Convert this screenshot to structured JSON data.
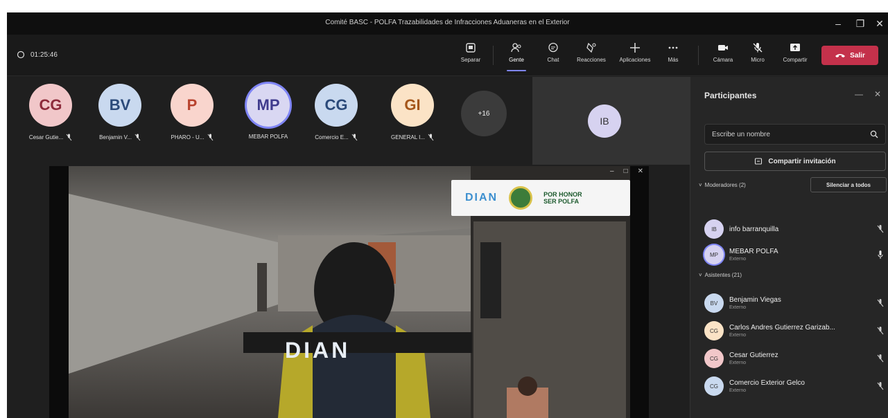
{
  "window": {
    "title": "Comité BASC - POLFA Trazabilidades de Infracciones Aduaneras en el Exterior"
  },
  "toolbar": {
    "timer": "01:25:46",
    "buttons": [
      {
        "name": "separate",
        "label": "Separar",
        "icon": "popout-icon"
      },
      {
        "name": "people",
        "label": "Gente",
        "icon": "people-icon",
        "active": true
      },
      {
        "name": "chat",
        "label": "Chat",
        "icon": "chat-icon"
      },
      {
        "name": "reactions",
        "label": "Reacciones",
        "icon": "reaction-icon"
      },
      {
        "name": "apps",
        "label": "Aplicaciones",
        "icon": "plus-icon"
      },
      {
        "name": "more",
        "label": "Más",
        "icon": "ellipsis-icon"
      },
      {
        "name": "camera",
        "label": "Cámara",
        "icon": "camera-icon"
      },
      {
        "name": "mic",
        "label": "Micro",
        "icon": "mic-off-icon"
      },
      {
        "name": "share",
        "label": "Compartir",
        "icon": "share-icon"
      }
    ],
    "leave_label": "Salir"
  },
  "strip": {
    "participants": [
      {
        "initials": "CG",
        "name": "Cesar Gutie...",
        "bg": "#f1c7c9",
        "fg": "#8d2b3b"
      },
      {
        "initials": "BV",
        "name": "Benjamin V...",
        "bg": "#c9d9ef",
        "fg": "#2b4a7a"
      },
      {
        "initials": "P",
        "name": "PHARO - U...",
        "bg": "#f9d5cd",
        "fg": "#b8432e"
      },
      {
        "initials": "MP",
        "name": "MEBAR POLFA",
        "bg": "#d9d7f2",
        "fg": "#3f3b8d",
        "speaking": true
      },
      {
        "initials": "CG",
        "name": "Comercio E...",
        "bg": "#c9d9ef",
        "fg": "#2b4a7a"
      },
      {
        "initials": "GI",
        "name": "GENERAL I...",
        "bg": "#fbe3c6",
        "fg": "#a5561a"
      }
    ],
    "more_count": "+16",
    "featured_initials": "IB"
  },
  "video": {
    "banner_brand": "DIAN",
    "banner_motto": "POR HONOR",
    "banner_unit": "SER POLFA",
    "vest_text": "DIAN"
  },
  "panel": {
    "title": "Participantes",
    "search_placeholder": "Escribe un nombre",
    "share_invite_label": "Compartir invitación",
    "moderators_label": "Moderadores (2)",
    "mute_all_label": "Silenciar a todos",
    "attendees_label": "Asistentes (21)",
    "moderators": [
      {
        "initials": "IB",
        "name": "info barranquilla",
        "subtitle": "",
        "bg": "#d6d2f0"
      },
      {
        "initials": "MP",
        "name": "MEBAR POLFA",
        "subtitle": "Externo",
        "bg": "#d6d2f0",
        "ring": true,
        "mic_on": true
      }
    ],
    "attendees": [
      {
        "initials": "BV",
        "name": "Benjamin Viegas",
        "subtitle": "Externo",
        "bg": "#c9d9ef"
      },
      {
        "initials": "CG",
        "name": "Carlos Andres Gutierrez Garizab...",
        "subtitle": "Externo",
        "bg": "#fbe3c6"
      },
      {
        "initials": "CG",
        "name": "Cesar Gutierrez",
        "subtitle": "Externo",
        "bg": "#f1c7c9"
      },
      {
        "initials": "CG",
        "name": "Comercio Exterior Gelco",
        "subtitle": "Externo",
        "bg": "#c9d9ef"
      }
    ]
  },
  "colors": {
    "accent": "#7f85f5",
    "leave": "#c4314b"
  }
}
